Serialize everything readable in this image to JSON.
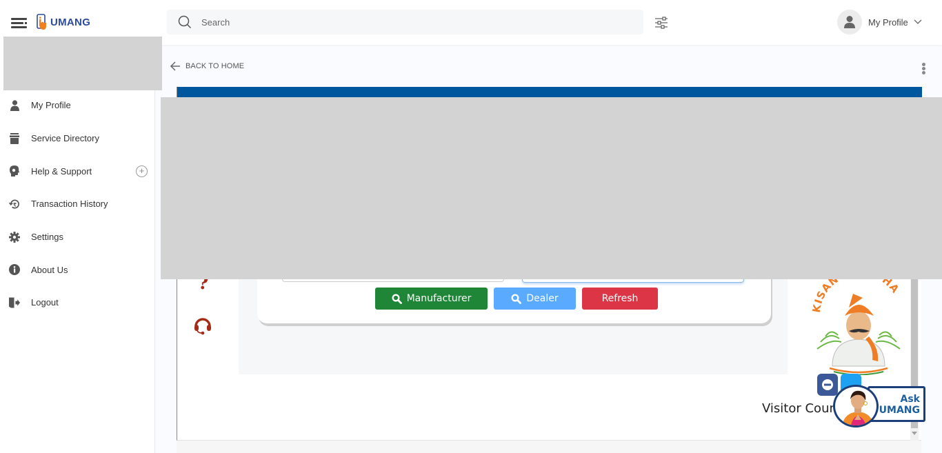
{
  "header": {
    "app_name": "UMANG",
    "search_placeholder": "Search",
    "profile_label": "My Profile"
  },
  "sidebar": {
    "items": [
      {
        "label": "My Profile",
        "icon": "user-icon"
      },
      {
        "label": "Service Directory",
        "icon": "archive-icon"
      },
      {
        "label": "Help & Support",
        "icon": "head-support-icon",
        "expandable": true
      },
      {
        "label": "Transaction History",
        "icon": "rupee-history-icon"
      },
      {
        "label": "Settings",
        "icon": "gear-icon"
      },
      {
        "label": "About Us",
        "icon": "info-icon"
      },
      {
        "label": "Logout",
        "icon": "logout-icon"
      }
    ],
    "expand_symbol": "+"
  },
  "main": {
    "back_label": "BACK TO HOME",
    "question_symbol": "?",
    "buttons": {
      "manufacturer": "Manufacturer",
      "dealer": "Dealer",
      "refresh": "Refresh"
    },
    "kisan_logo_text": "KISAN SUVIDHA",
    "visitor_label": "Visitor Count",
    "ask_widget": {
      "line1": "Ask",
      "line2": "UMANG"
    }
  },
  "colors": {
    "brand_blue": "#2b4a9a",
    "banner_blue": "#00579e",
    "manufacturer_green": "#1f8638",
    "dealer_blue": "#5aabff",
    "refresh_red": "#dc3545",
    "icon_maroon": "#a32b18"
  }
}
